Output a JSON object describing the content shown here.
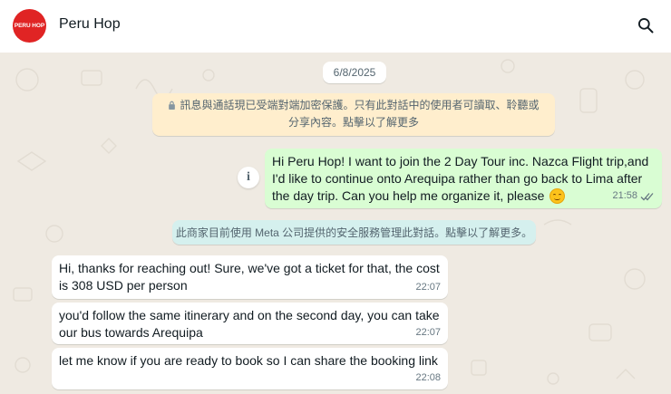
{
  "header": {
    "avatar_text": "PERU HOP",
    "contact_name": "Peru Hop",
    "search_icon": "search-icon"
  },
  "chat": {
    "date": "6/8/2025",
    "encryption_notice": "訊息與通話現已受端對端加密保護。只有此對話中的使用者可讀取、聆聽或分享內容。點擊以了解更多",
    "outgoing": {
      "text": "Hi Peru Hop! I want to join the 2 Day Tour inc. Nazca Flight trip,and I'd like to continue onto Arequipa rather than go back to Lima after the day trip. Can you help me organize it, please",
      "emoji": "smiling-face",
      "time": "21:58",
      "status": "read-ticks"
    },
    "system_notice": "此商家目前使用 Meta 公司提供的安全服務管理此對話。點擊以了解更多。",
    "incoming": [
      {
        "text": "Hi, thanks for reaching out! Sure, we've got a ticket for that, the cost is 308 USD per person",
        "time": "22:07"
      },
      {
        "text": "you'd follow the same itinerary and on the second day, you can take our bus towards Arequipa",
        "time": "22:07"
      },
      {
        "text": "let me know if you are ready to book so I can share the booking link",
        "time": "22:08"
      }
    ]
  },
  "colors": {
    "outgoing_bubble": "#d9fdd3",
    "incoming_bubble": "#ffffff",
    "encryption_bg": "#ffeecd",
    "system_bg": "#d5f0ee",
    "brand_red": "#e02424"
  }
}
